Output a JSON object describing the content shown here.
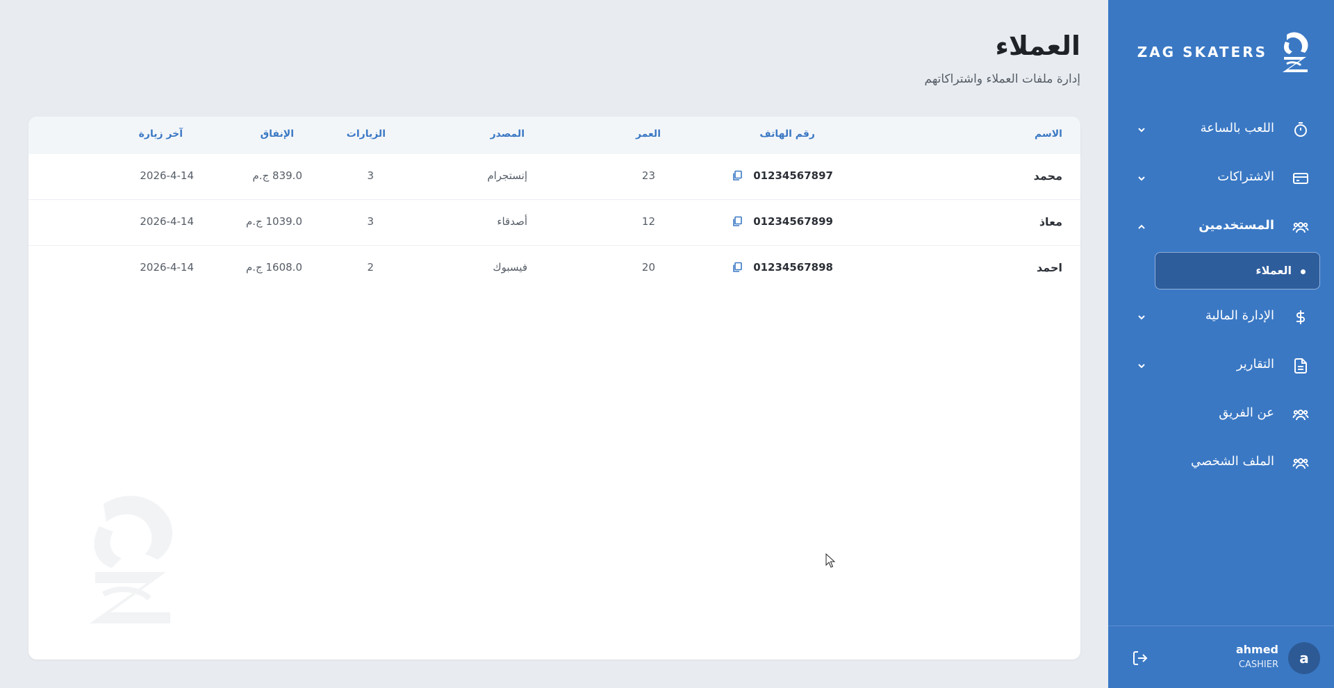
{
  "brand": {
    "name": "ZAG SKATERS"
  },
  "page": {
    "title": "العملاء",
    "subtitle": "إدارة ملفات العملاء واشتراكاتهم"
  },
  "sidebar": {
    "items": [
      {
        "label": "اللعب بالساعة",
        "icon": "timer-icon",
        "expandable": true
      },
      {
        "label": "الاشتراكات",
        "icon": "card-icon",
        "expandable": true
      },
      {
        "label": "المستخدمين",
        "icon": "users-icon",
        "expandable": true,
        "expanded": true
      },
      {
        "label": "الإدارة المالية",
        "icon": "dollar-icon",
        "expandable": true
      },
      {
        "label": "التقارير",
        "icon": "document-icon",
        "expandable": true
      },
      {
        "label": "عن الفريق",
        "icon": "users-icon",
        "expandable": false
      },
      {
        "label": "الملف الشخصي",
        "icon": "users-icon",
        "expandable": false
      }
    ],
    "sub_item": {
      "label": "العملاء"
    },
    "user": {
      "initial": "a",
      "name": "ahmed",
      "role": "CASHIER"
    }
  },
  "table": {
    "headers": {
      "name": "الاسم",
      "phone": "رقم الهاتف",
      "age": "العمر",
      "source": "المصدر",
      "visits": "الزيارات",
      "spending": "الإنفاق",
      "last_visit": "آخر زيارة"
    },
    "rows": [
      {
        "name": "محمد",
        "phone": "01234567897",
        "age": "23",
        "source": "إنستجرام",
        "visits": "3",
        "spending": "839.0 ج.م",
        "last_visit": "2026-4-14"
      },
      {
        "name": "معاذ",
        "phone": "01234567899",
        "age": "12",
        "source": "أصدقاء",
        "visits": "3",
        "spending": "1039.0 ج.م",
        "last_visit": "2026-4-14"
      },
      {
        "name": "احمد",
        "phone": "01234567898",
        "age": "20",
        "source": "فيسبوك",
        "visits": "2",
        "spending": "1608.0 ج.م",
        "last_visit": "2026-4-14"
      }
    ]
  },
  "colors": {
    "sidebar": "#3a78c4",
    "accent": "#3a78c4",
    "background": "#e8ecf0"
  }
}
